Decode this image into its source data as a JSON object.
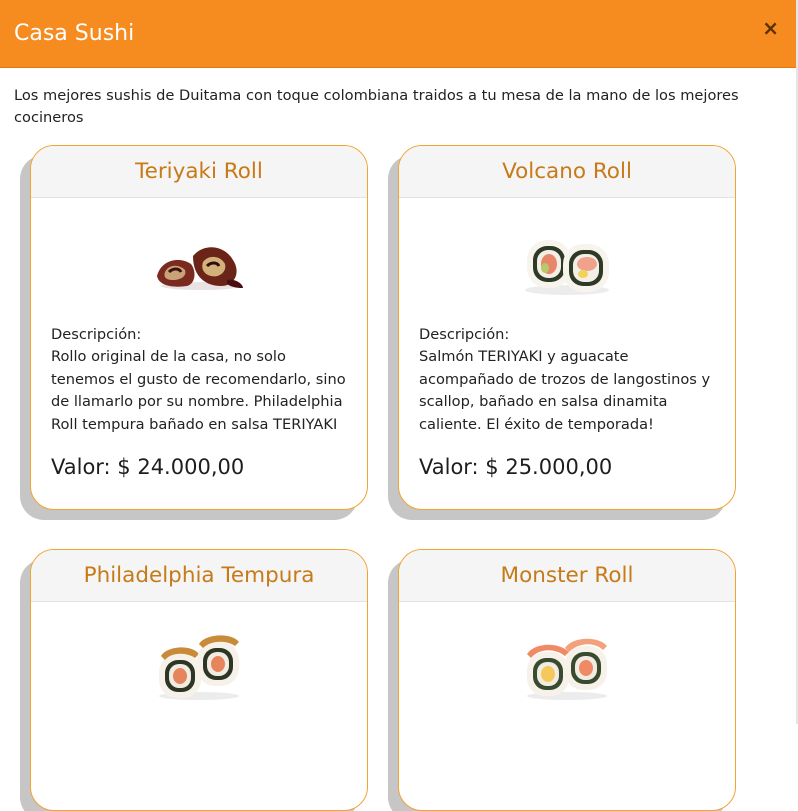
{
  "modal": {
    "title": "Casa Sushi",
    "close_label": "×",
    "intro": "Los mejores sushis de Duitama con toque colombiana traidos a tu mesa de la mano de los mejores cocineros"
  },
  "colors": {
    "header_bg": "#f68b1f",
    "card_title": "#c77a18",
    "card_border": "#f2a332"
  },
  "menu": [
    {
      "name": "Teriyaki Roll",
      "description_label": "Descripción:",
      "description": "Rollo original de la casa, no solo tenemos el gusto de recomendarlo, sino de llamarlo por su nombre. Philadelphia Roll tempura bañado en salsa TERIYAKI",
      "price": "Valor: $ 24.000,00"
    },
    {
      "name": "Volcano Roll",
      "description_label": "Descripción:",
      "description": "Salmón TERIYAKI y aguacate acompañado de trozos de langostinos y scallop, bañado en salsa dinamita caliente. El éxito de temporada!",
      "price": "Valor: $ 25.000,00"
    },
    {
      "name": "Philadelphia Tempura"
    },
    {
      "name": "Monster Roll"
    }
  ]
}
